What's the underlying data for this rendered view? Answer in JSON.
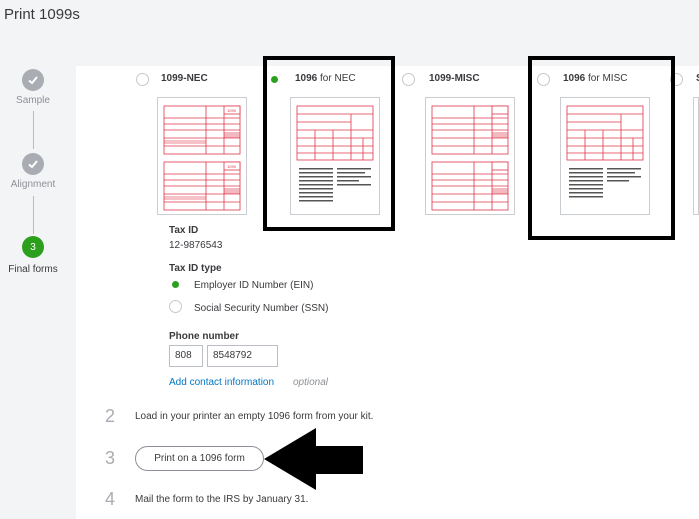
{
  "page": {
    "title": "Print 1099s"
  },
  "stepper": [
    {
      "number": "",
      "label": "Sample",
      "state": "done"
    },
    {
      "number": "",
      "label": "Alignment",
      "state": "done"
    },
    {
      "number": "3",
      "label": "Final forms",
      "state": "active"
    }
  ],
  "form_options": [
    {
      "label_bold": "1099-NEC",
      "label_light": "",
      "selected": false
    },
    {
      "label_bold": "1096",
      "label_light": " for NEC",
      "selected": true
    },
    {
      "label_bold": "1099-MISC",
      "label_light": "",
      "selected": false
    },
    {
      "label_bold": "1096",
      "label_light": " for MISC",
      "selected": false
    },
    {
      "label_bold": "S",
      "label_light": "",
      "selected": false
    }
  ],
  "thumb_badge": "1099",
  "tax": {
    "id_label": "Tax ID",
    "id_value": "12-9876543",
    "type_label": "Tax ID type",
    "options": [
      {
        "label": "Employer ID Number (EIN)",
        "selected": true
      },
      {
        "label": "Social Security Number (SSN)",
        "selected": false
      }
    ]
  },
  "phone": {
    "label": "Phone number",
    "area": "808",
    "number": "8548792"
  },
  "contact": {
    "link": "Add contact information",
    "optional": "optional"
  },
  "steps": [
    {
      "num": "2",
      "text": "Load in your printer an empty 1096 form from your kit."
    },
    {
      "num": "3",
      "button": "Print on a 1096 form"
    },
    {
      "num": "4",
      "text": "Mail the form to the IRS by January 31."
    }
  ],
  "colors": {
    "accent": "#2ca01c",
    "form_red": "#e0364a",
    "link": "#0077c5"
  }
}
